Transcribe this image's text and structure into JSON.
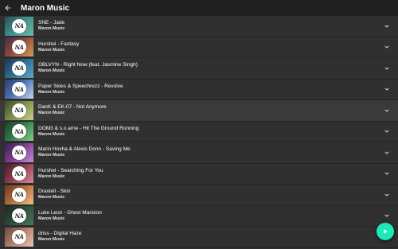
{
  "appbar": {
    "title": "Maron Music",
    "back_icon": "arrow-back-icon"
  },
  "thumbnail_logo_text": "NA",
  "tracks": [
    {
      "title": "SNE - Jade",
      "artist": "Maron Music",
      "thumb_colors": [
        "#3b8d86",
        "#6fb8a8",
        "#2d4c5a"
      ],
      "active": false
    },
    {
      "title": "Hurshel - Fantasy",
      "artist": "Maron Music",
      "thumb_colors": [
        "#8c4a3a",
        "#d9985a",
        "#3d2c4a"
      ],
      "active": false
    },
    {
      "title": "OBLVYN - Right Now (feat. Jasmine Singh)",
      "artist": "Maron Music",
      "thumb_colors": [
        "#2e6a8c",
        "#5fa7c9",
        "#1e3550"
      ],
      "active": false
    },
    {
      "title": "Paper Skies & Speechrezz - Revolve",
      "artist": "Maron Music",
      "thumb_colors": [
        "#4a6fb0",
        "#c9d6ef",
        "#2b3f6e"
      ],
      "active": false
    },
    {
      "title": "DanK & EK-07 - Not Anymore",
      "artist": "Maron Music",
      "thumb_colors": [
        "#7a8a4a",
        "#c8d08a",
        "#3e4a2a"
      ],
      "active": true
    },
    {
      "title": "DOM3 & s.o.arne - Hit The Ground Running",
      "artist": "Maron Music",
      "thumb_colors": [
        "#2d7a4a",
        "#8cc98a",
        "#1b3e2a"
      ],
      "active": false
    },
    {
      "title": "Marin Hoxha & Alexis Donn - Saving Me",
      "artist": "Maron Music",
      "thumb_colors": [
        "#7a3a8c",
        "#c98ad9",
        "#3a1e50"
      ],
      "active": false
    },
    {
      "title": "Hurshel - Searching For You",
      "artist": "Maron Music",
      "thumb_colors": [
        "#8c3a4a",
        "#d98a9a",
        "#4a1e2a"
      ],
      "active": false
    },
    {
      "title": "Draxtell - Skin",
      "artist": "Maron Music",
      "thumb_colors": [
        "#b06a3a",
        "#efc08a",
        "#6a3a1e"
      ],
      "active": false
    },
    {
      "title": "Luke Leon - Ghost Mansion",
      "artist": "Maron Music",
      "thumb_colors": [
        "#2a4a3a",
        "#4a7a5a",
        "#1a2a22"
      ],
      "active": false
    },
    {
      "title": "driss - Digital Haze",
      "artist": "Maron Music",
      "thumb_colors": [
        "#b07a6a",
        "#e8c8b0",
        "#6a4a3a"
      ],
      "active": false
    }
  ],
  "expand_icon": "chevron-down-icon",
  "fab": {
    "icon": "play-icon",
    "color": "#1de9b6"
  }
}
